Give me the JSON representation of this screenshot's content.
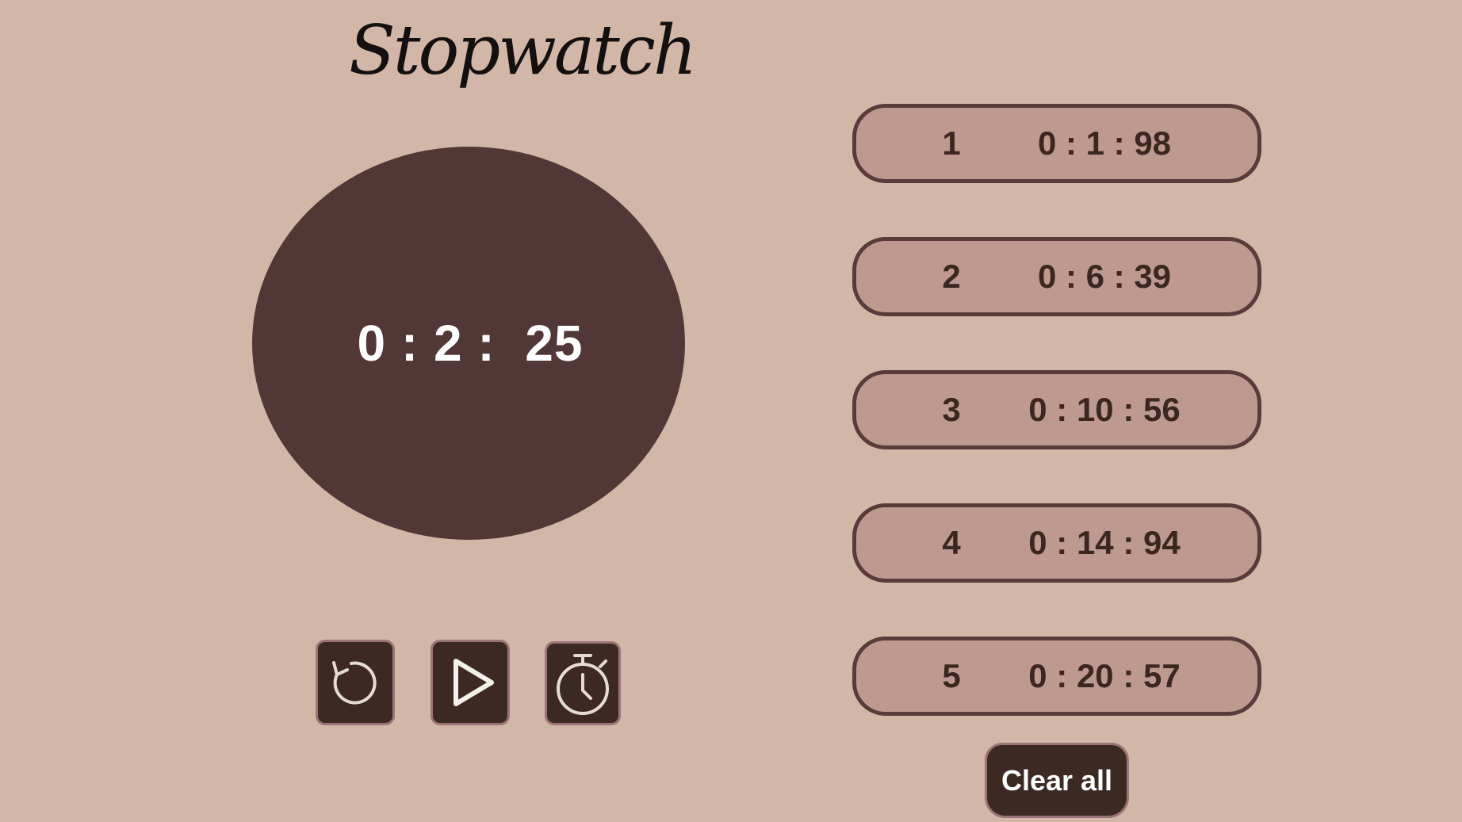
{
  "app": {
    "title": "Stopwatch"
  },
  "display": {
    "time": "0 : 2 :  25"
  },
  "controls": {
    "reset_icon": "reset-icon",
    "play_icon": "play-icon",
    "lap_icon": "stopwatch-icon"
  },
  "laps": [
    {
      "number": "1",
      "time": "0 : 1 : 98"
    },
    {
      "number": "2",
      "time": "0 : 6 : 39"
    },
    {
      "number": "3",
      "time": "0 : 10 : 56"
    },
    {
      "number": "4",
      "time": "0 : 14 : 94"
    },
    {
      "number": "5",
      "time": "0 : 20 : 57"
    }
  ],
  "actions": {
    "clear_label": "Clear all"
  },
  "colors": {
    "background": "#d2b6a7",
    "dial": "#523737",
    "lap_fill": "#bd9990",
    "lap_border": "#5a3b3b",
    "button": "#3c2a22",
    "button_border": "#9b7477"
  }
}
